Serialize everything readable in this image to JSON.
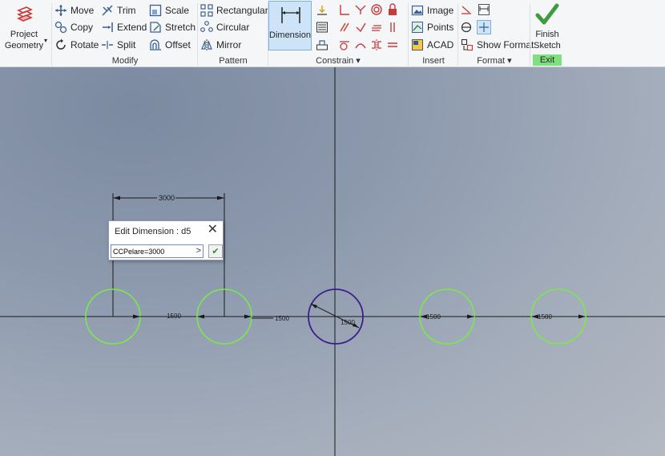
{
  "ribbon": {
    "project_geometry": "Project\nGeometry",
    "modify": {
      "label": "Modify",
      "move": "Move",
      "trim": "Trim",
      "scale": "Scale",
      "copy": "Copy",
      "extend": "Extend",
      "stretch": "Stretch",
      "rotate": "Rotate",
      "split": "Split",
      "offset": "Offset"
    },
    "pattern": {
      "label": "Pattern",
      "rectangular": "Rectangular",
      "circular": "Circular",
      "mirror": "Mirror"
    },
    "constrain": {
      "label": "Constrain ▾",
      "dimension": "Dimension"
    },
    "insert": {
      "label": "Insert",
      "image": "Image",
      "points": "Points",
      "acad": "ACAD"
    },
    "format": {
      "label": "Format ▾",
      "show_format": "Show Format"
    },
    "exit": {
      "label": "Exit",
      "finish_sketch": "Finish\nSketch",
      "accent": "#7fe07f"
    }
  },
  "sketch": {
    "dim_top": "3000",
    "dim_labels": [
      "1500",
      "1500",
      "1500",
      "1500",
      "1500"
    ],
    "colors": {
      "circle_free": "#7de84a",
      "circle_active": "#3b1e8c",
      "line": "#1a1a1a"
    }
  },
  "dialog": {
    "title": "Edit Dimension : d5",
    "value": "CCPelare=3000",
    "close": "✕",
    "arrow": ">",
    "ok": "✔"
  }
}
